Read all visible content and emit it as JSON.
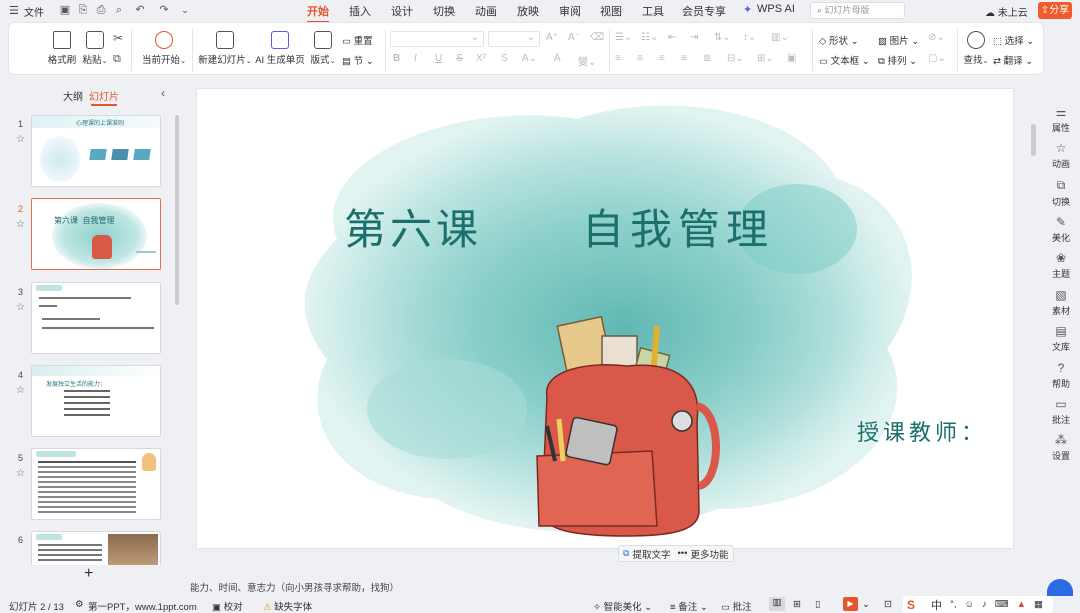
{
  "titlebar": {
    "file_label": "文件",
    "menu_tabs": [
      "开始",
      "插入",
      "设计",
      "切换",
      "动画",
      "放映",
      "审阅",
      "视图",
      "工具",
      "会员专享",
      "WPS AI"
    ],
    "search_placeholder": "幻灯片母版",
    "cloud_label": "未上云",
    "share_label": "分享"
  },
  "ribbon": {
    "format_painter": "格式刷",
    "paste": "粘贴",
    "play_from_current": "当前开始",
    "new_slide": "新建幻灯片",
    "ai_generate": "AI 生成单页",
    "layout": "版式",
    "reset": "重置",
    "section": "节",
    "shape": "形状",
    "picture": "图片",
    "textbox": "文本框",
    "arrange": "排列",
    "find": "查找",
    "select": "选择",
    "translate": "翻译"
  },
  "left_panel": {
    "tab_outline": "大纲",
    "tab_slides": "幻灯片",
    "add_icon": "plus-icon",
    "thumbnails": [
      {
        "num": "1",
        "title": "心理课的上课准则"
      },
      {
        "num": "2",
        "title": "第六课  自我管理"
      },
      {
        "num": "3",
        "title": "小提问"
      },
      {
        "num": "4",
        "title": "发展独立生活的能力："
      },
      {
        "num": "5",
        "title": "小组讨论"
      },
      {
        "num": "6",
        "title": "名人故事"
      }
    ]
  },
  "slide": {
    "title_part1": "第六课",
    "title_part2": "自我管理",
    "teacher_label": "授课教师："
  },
  "floatbar": {
    "extract_text": "提取文字",
    "more_functions": "更多功能"
  },
  "notes": {
    "text": "能力、时间、意志力（向小男孩寻求帮助，找狗）"
  },
  "statusbar": {
    "slide_indicator": "幻灯片 2 / 13",
    "theme_name": "第一PPT，www.1ppt.com",
    "proofread": "校对",
    "missing_font": "缺失字体",
    "smart_beautify": "智能美化",
    "notes_label": "备注",
    "comments_label": "批注"
  },
  "right_rail": {
    "items": [
      "属性",
      "动画",
      "切换",
      "美化",
      "主题",
      "素材",
      "文库",
      "帮助",
      "批注",
      "设置"
    ]
  },
  "colors": {
    "accent": "#e4572e",
    "share_bg": "#f25a2c",
    "title_teal": "#1b6f6d"
  }
}
